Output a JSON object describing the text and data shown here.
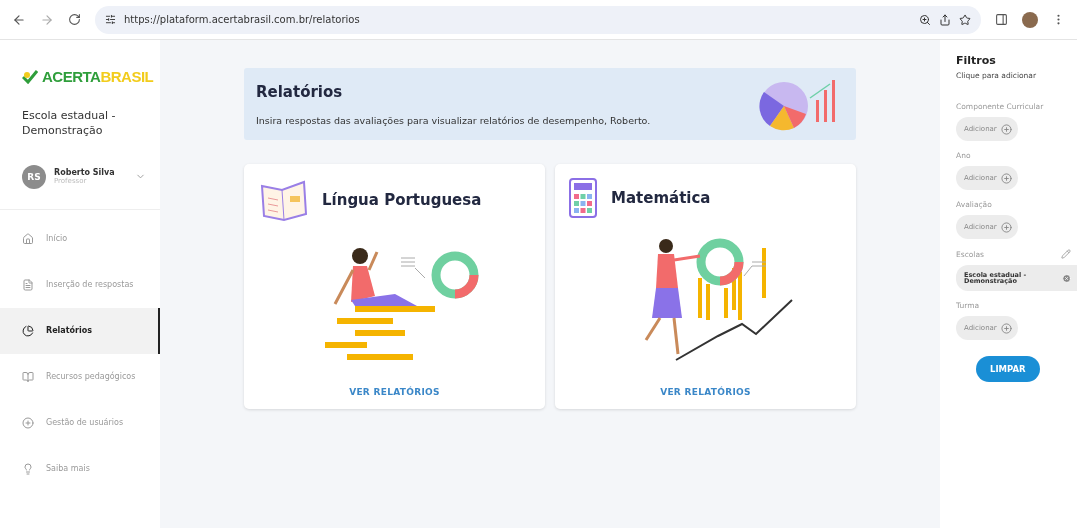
{
  "browser": {
    "url": "https://plataform.acertabrasil.com.br/relatorios"
  },
  "sidebar": {
    "logo": {
      "part1": "ACERTA",
      "part2": "BRASIL"
    },
    "school": "Escola estadual - Demonstração",
    "user": {
      "initials": "RS",
      "name": "Roberto Silva",
      "role": "Professor"
    },
    "items": [
      {
        "label": "Início",
        "selected": false
      },
      {
        "label": "Inserção de respostas",
        "selected": false
      },
      {
        "label": "Relatórios",
        "selected": true
      },
      {
        "label": "Recursos pedagógicos",
        "selected": false
      },
      {
        "label": "Gestão de usuários",
        "selected": false
      },
      {
        "label": "Saiba mais",
        "selected": false
      }
    ]
  },
  "banner": {
    "title": "Relatórios",
    "text": "Insira respostas das avaliações para visualizar relatórios de desempenho, Roberto."
  },
  "cards": [
    {
      "title": "Língua Portuguesa",
      "link": "VER RELATÓRIOS"
    },
    {
      "title": "Matemática",
      "link": "VER RELATÓRIOS"
    }
  ],
  "filters": {
    "title": "Filtros",
    "hint": "Clique para adicionar",
    "groups": [
      {
        "label": "Componente Curricular",
        "kind": "add",
        "button": "Adicionar"
      },
      {
        "label": "Ano",
        "kind": "add",
        "button": "Adicionar"
      },
      {
        "label": "Avaliação",
        "kind": "add",
        "button": "Adicionar"
      },
      {
        "label": "Escolas",
        "kind": "chip",
        "chip": "Escola estadual - Demonstração"
      },
      {
        "label": "Turma",
        "kind": "add",
        "button": "Adicionar"
      }
    ],
    "clear": "LIMPAR"
  }
}
